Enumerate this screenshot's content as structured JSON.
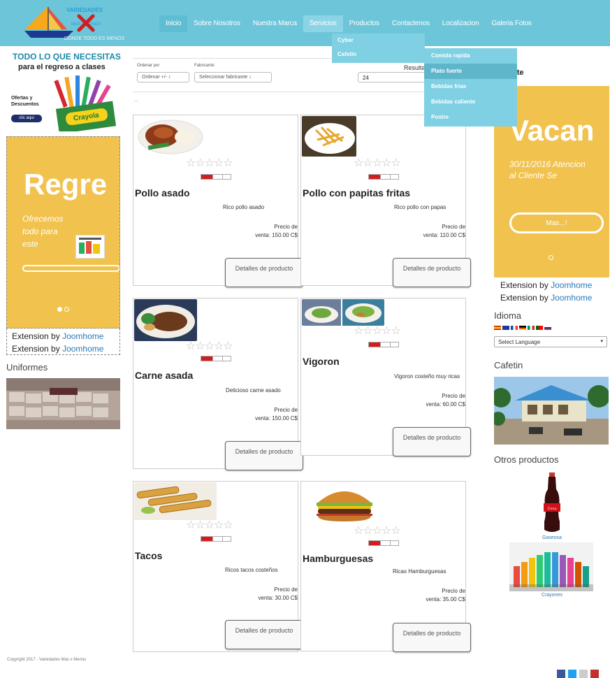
{
  "header": {
    "logo": {
      "line1": "VARIEDADES",
      "line2": "MAS X MENOS",
      "tagline": "DONDE TODO ES MENOS"
    },
    "nav": [
      {
        "label": "Inicio"
      },
      {
        "label": "Sobre Nosotros"
      },
      {
        "label": "Nuestra Marca"
      },
      {
        "label": "Servicios"
      },
      {
        "label": "Productos"
      },
      {
        "label": "Contactenos"
      },
      {
        "label": "Localizacion"
      },
      {
        "label": "Galeria Fotos"
      }
    ],
    "servicios_menu": [
      {
        "label": "Cyber"
      },
      {
        "label": "Cafetin"
      }
    ],
    "cafetin_menu": [
      {
        "label": "Comida rapida"
      },
      {
        "label": "Plato fuerte"
      },
      {
        "label": "Bebidas frias"
      },
      {
        "label": "Bebidas caliente"
      },
      {
        "label": "Postre"
      }
    ]
  },
  "left_sidebar": {
    "ad": {
      "title": "TODO LO QUE NECESITAS",
      "subtitle": "para el regreso a clases",
      "offer": "Ofertas y Descuentos",
      "cta": "clic aqui",
      "brand": "Crayola"
    },
    "slider": {
      "heading": "Regre",
      "text": "Ofrecemos todo para este"
    },
    "ext1": {
      "prefix": "Extension by",
      "link": "Joomhome"
    },
    "ext2": {
      "prefix": "Extension by",
      "link": "Joomhome"
    },
    "uniformes_title": "Uniformes"
  },
  "toolbar": {
    "order_label": "Ordenar por",
    "order_button": "Ordenar +/-",
    "maker_label": "Fabricante:",
    "maker_button": "Seleccionar fabricante",
    "results_label": "Resulta",
    "results_value": "24",
    "ellipsis": "..."
  },
  "products": [
    {
      "name": "Pollo asado",
      "desc": "Rico pollo asado",
      "price_label": "Precio de",
      "price": "venta:   150.00 C$",
      "button": "Detalles de producto"
    },
    {
      "name": "Pollo con papitas fritas",
      "desc": "Rico pollo con papas",
      "price_label": "Precio de",
      "price": "venta:   110.00 C$",
      "button": "Detalles de producto"
    },
    {
      "name": "Carne asada",
      "desc": "Delicioso carne asado",
      "price_label": "Precio de",
      "price": "venta:   150.00 C$",
      "button": "Detalles de producto"
    },
    {
      "name": "Vigoron",
      "desc": "Vigoron costeño muy ricas",
      "price_label": "Precio de",
      "price": "venta:   60.00 C$",
      "button": "Detalles de producto"
    },
    {
      "name": "Tacos",
      "desc": "Ricos tacos costeños",
      "price_label": "Precio de",
      "price": "venta:   30.00 C$",
      "button": "Detalles de producto"
    },
    {
      "name": "Hamburguesas",
      "desc": "Ricas Hamburguesas",
      "price_label": "Precio de",
      "price": "venta:   35.00 C$",
      "button": "Detalles de producto"
    }
  ],
  "right_sidebar": {
    "title_fragment": "nte",
    "slider": {
      "heading": "Vacan",
      "text": "30/11/2016 Atencion al Cliente Se",
      "button": "Mas...!"
    },
    "ext1": {
      "prefix": "Extension by",
      "link": "Joomhome"
    },
    "ext2": {
      "prefix": "Extension by",
      "link": "Joomhome"
    },
    "idioma_title": "Idioma",
    "language_select": "Select Language",
    "cafetin_title": "Cafetin",
    "otros_title": "Otros productos",
    "items": [
      {
        "caption": "Gaseosa"
      },
      {
        "caption": "Crayones"
      }
    ]
  },
  "footer": {
    "copyright": "Copyright  2017 - Variedades Mas x Menos"
  },
  "colors": {
    "header_bg": "#6cc5d8",
    "menu_bg": "#7fd0e2",
    "slider_bg": "#f1c24e",
    "rating_red": "#d31c1c"
  },
  "rating": {
    "value": 0,
    "max": 5
  }
}
